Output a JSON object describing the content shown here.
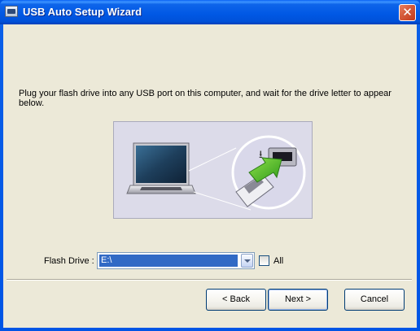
{
  "window": {
    "title": "USB Auto Setup Wizard",
    "close_label": "✕"
  },
  "instruction_text": "Plug your flash drive into any USB port on this computer, and wait for the drive letter to appear below.",
  "illustration": {
    "description_icons": [
      "laptop-icon",
      "usb-port-icon",
      "usb-plug-icon",
      "insert-arrow-icon"
    ]
  },
  "flash_drive": {
    "label": "Flash Drive :",
    "selected_value": "E:\\",
    "all_checkbox_label": "All",
    "all_checked": false
  },
  "buttons": {
    "back": "< Back",
    "next": "Next >",
    "cancel": "Cancel"
  },
  "colors": {
    "titlebar": "#0058e4",
    "client_bg": "#ece9d8",
    "selection": "#316ac5",
    "illustration_bg": "#dcdbe9"
  }
}
